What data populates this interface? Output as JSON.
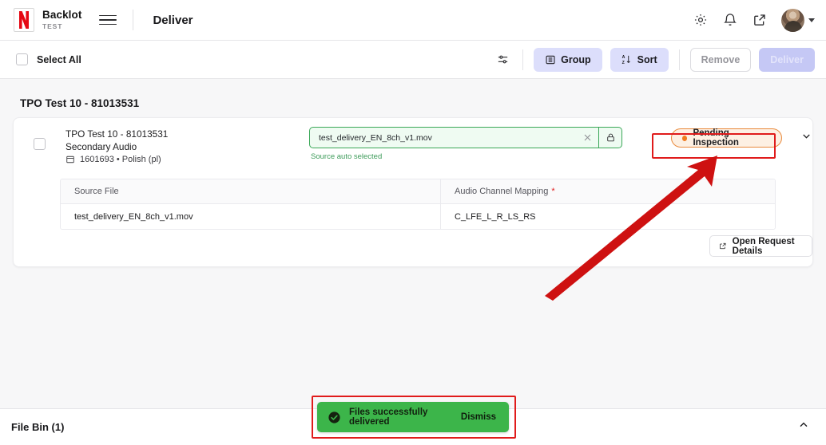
{
  "header": {
    "brand_name": "Backlot",
    "brand_sub": "TEST",
    "menu_icon": "hamburger-icon",
    "page_title": "Deliver",
    "icons": [
      "gear-icon",
      "bell-icon",
      "external-link-icon"
    ],
    "avatar_caret": "chevron-down-icon"
  },
  "toolbar": {
    "select_all_label": "Select All",
    "filter_icon": "filter-settings-icon",
    "group_label": "Group",
    "sort_label": "Sort",
    "remove_label": "Remove",
    "deliver_label": "Deliver"
  },
  "group": {
    "title": "TPO Test 10 - 81013531"
  },
  "item": {
    "title": "TPO Test 10 - 81013531",
    "subtitle": "Secondary Audio",
    "meta": "1601693 • Polish (pl)",
    "meta_icon": "media-box-icon",
    "file_value": "test_delivery_EN_8ch_v1.mov",
    "file_clear_icon": "close-icon",
    "file_lock_icon": "lock-icon",
    "helper_text": "Source auto selected",
    "status_label": "Pending Inspection",
    "expand_icon": "chevron-down-icon",
    "open_details_label": "Open Request Details",
    "open_details_icon": "external-link-icon"
  },
  "table": {
    "columns": [
      "Source File",
      "Audio Channel Mapping"
    ],
    "required_marker": "*",
    "rows": [
      {
        "source_file": "test_delivery_EN_8ch_v1.mov",
        "audio_channel_mapping": "C_LFE_L_R_LS_RS"
      }
    ]
  },
  "filebin": {
    "title": "File Bin (1)",
    "collapse_icon": "chevron-up-icon"
  },
  "toast": {
    "message": "Files successfully delivered",
    "dismiss_label": "Dismiss",
    "icon": "check-circle-icon"
  },
  "colors": {
    "brand_red": "#e50914",
    "annotation_red": "#e01b1b",
    "accent_lavender": "#dcdefb",
    "status_orange": "#f07c20",
    "success_green": "#3cb54a",
    "field_green": "#3aa757",
    "page_bg": "#f7f7f8"
  }
}
